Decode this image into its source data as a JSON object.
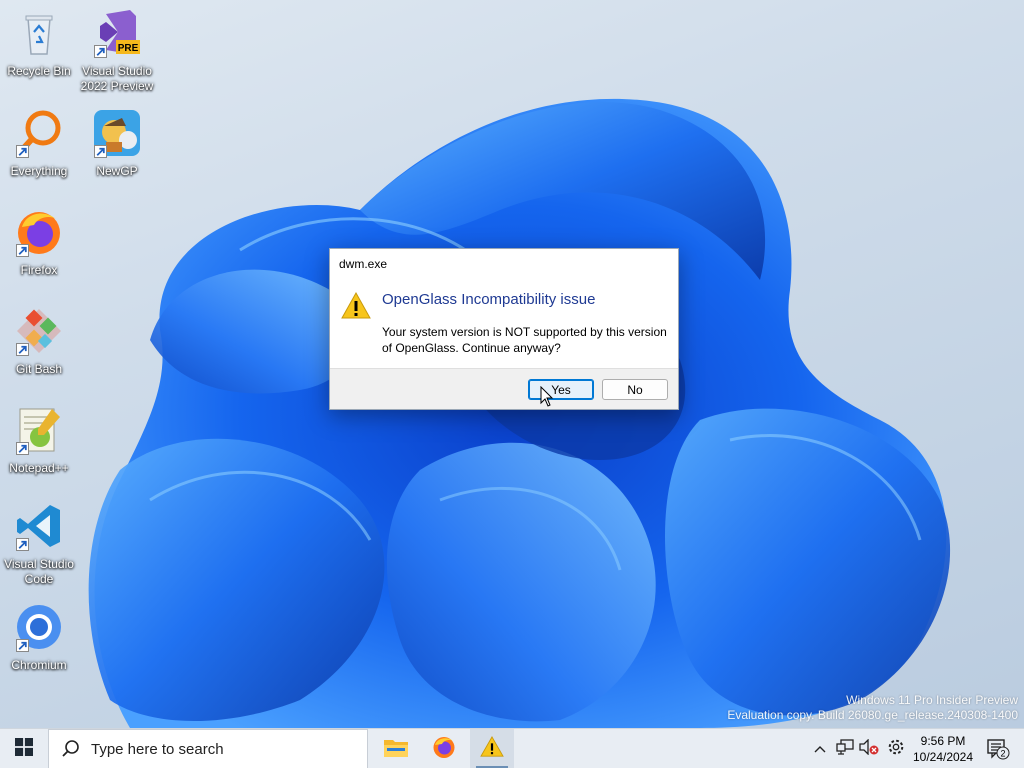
{
  "desktop": {
    "icons": [
      {
        "label": "Recycle Bin",
        "icon": "recycle-bin-icon"
      },
      {
        "label": "Visual Studio 2022 Preview",
        "icon": "visual-studio-preview-icon",
        "badge": "PRE"
      },
      {
        "label": "Everything",
        "icon": "everything-search-icon"
      },
      {
        "label": "NewGP",
        "icon": "newgp-icon"
      },
      {
        "label": "Firefox",
        "icon": "firefox-icon"
      },
      {
        "label": "Git Bash",
        "icon": "git-bash-icon"
      },
      {
        "label": "Notepad++",
        "icon": "notepad-plus-plus-icon"
      },
      {
        "label": "Visual Studio Code",
        "icon": "vscode-icon"
      },
      {
        "label": "Chromium",
        "icon": "chromium-icon"
      }
    ]
  },
  "dialog": {
    "title": "dwm.exe",
    "heading": "OpenGlass Incompatibility issue",
    "message": "Your system version is NOT supported by this version of OpenGlass. Continue anyway?",
    "yes_label": "Yes",
    "no_label": "No",
    "icon": "warning-icon"
  },
  "watermark": {
    "line1": "Windows 11 Pro Insider Preview",
    "line2": "Evaluation copy. Build 26080.ge_release.240308-1400"
  },
  "taskbar": {
    "search_placeholder": "Type here to search",
    "apps": [
      "file-explorer-icon",
      "firefox-icon",
      "warning-icon"
    ],
    "clock_time": "9:56 PM",
    "clock_date": "10/24/2024",
    "notification_count": "2"
  },
  "colors": {
    "accent": "#0078d4",
    "wallpaper_blue": "#1a5fe0",
    "dialog_heading": "#1f3a93"
  }
}
